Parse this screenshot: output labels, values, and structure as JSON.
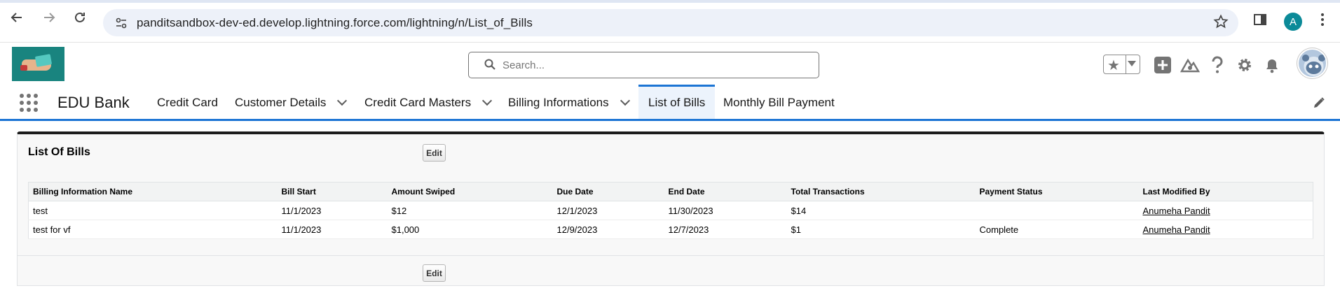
{
  "browser": {
    "url": "panditsandbox-dev-ed.develop.lightning.force.com/lightning/n/List_of_Bills",
    "profile_initial": "A"
  },
  "header": {
    "search_placeholder": "Search..."
  },
  "app": {
    "name": "EDU Bank",
    "nav_items": [
      {
        "label": "Credit Card"
      },
      {
        "label": "Customer Details"
      },
      {
        "label": "Credit Card Masters"
      },
      {
        "label": "Billing Informations"
      },
      {
        "label": "List of Bills"
      },
      {
        "label": "Monthly Bill Payment"
      }
    ]
  },
  "page": {
    "title": "List Of Bills",
    "edit_label": "Edit",
    "columns": [
      "Billing Information Name",
      "Bill Start",
      "Amount Swiped",
      "Due Date",
      "End Date",
      "Total Transactions",
      "Payment Status",
      "Last Modified By"
    ],
    "rows": [
      [
        "test",
        "11/1/2023",
        "$12",
        "12/1/2023",
        "11/30/2023",
        "$14",
        "",
        "Anumeha Pandit"
      ],
      [
        "test for vf",
        "11/1/2023",
        "$1,000",
        "12/9/2023",
        "12/7/2023",
        "$1",
        "Complete",
        "Anumeha Pandit"
      ]
    ]
  },
  "colors": {
    "brand_blue": "#1b74d4",
    "active_tab_bg": "#ecf3fc",
    "profile_teal": "#0b8a98"
  }
}
